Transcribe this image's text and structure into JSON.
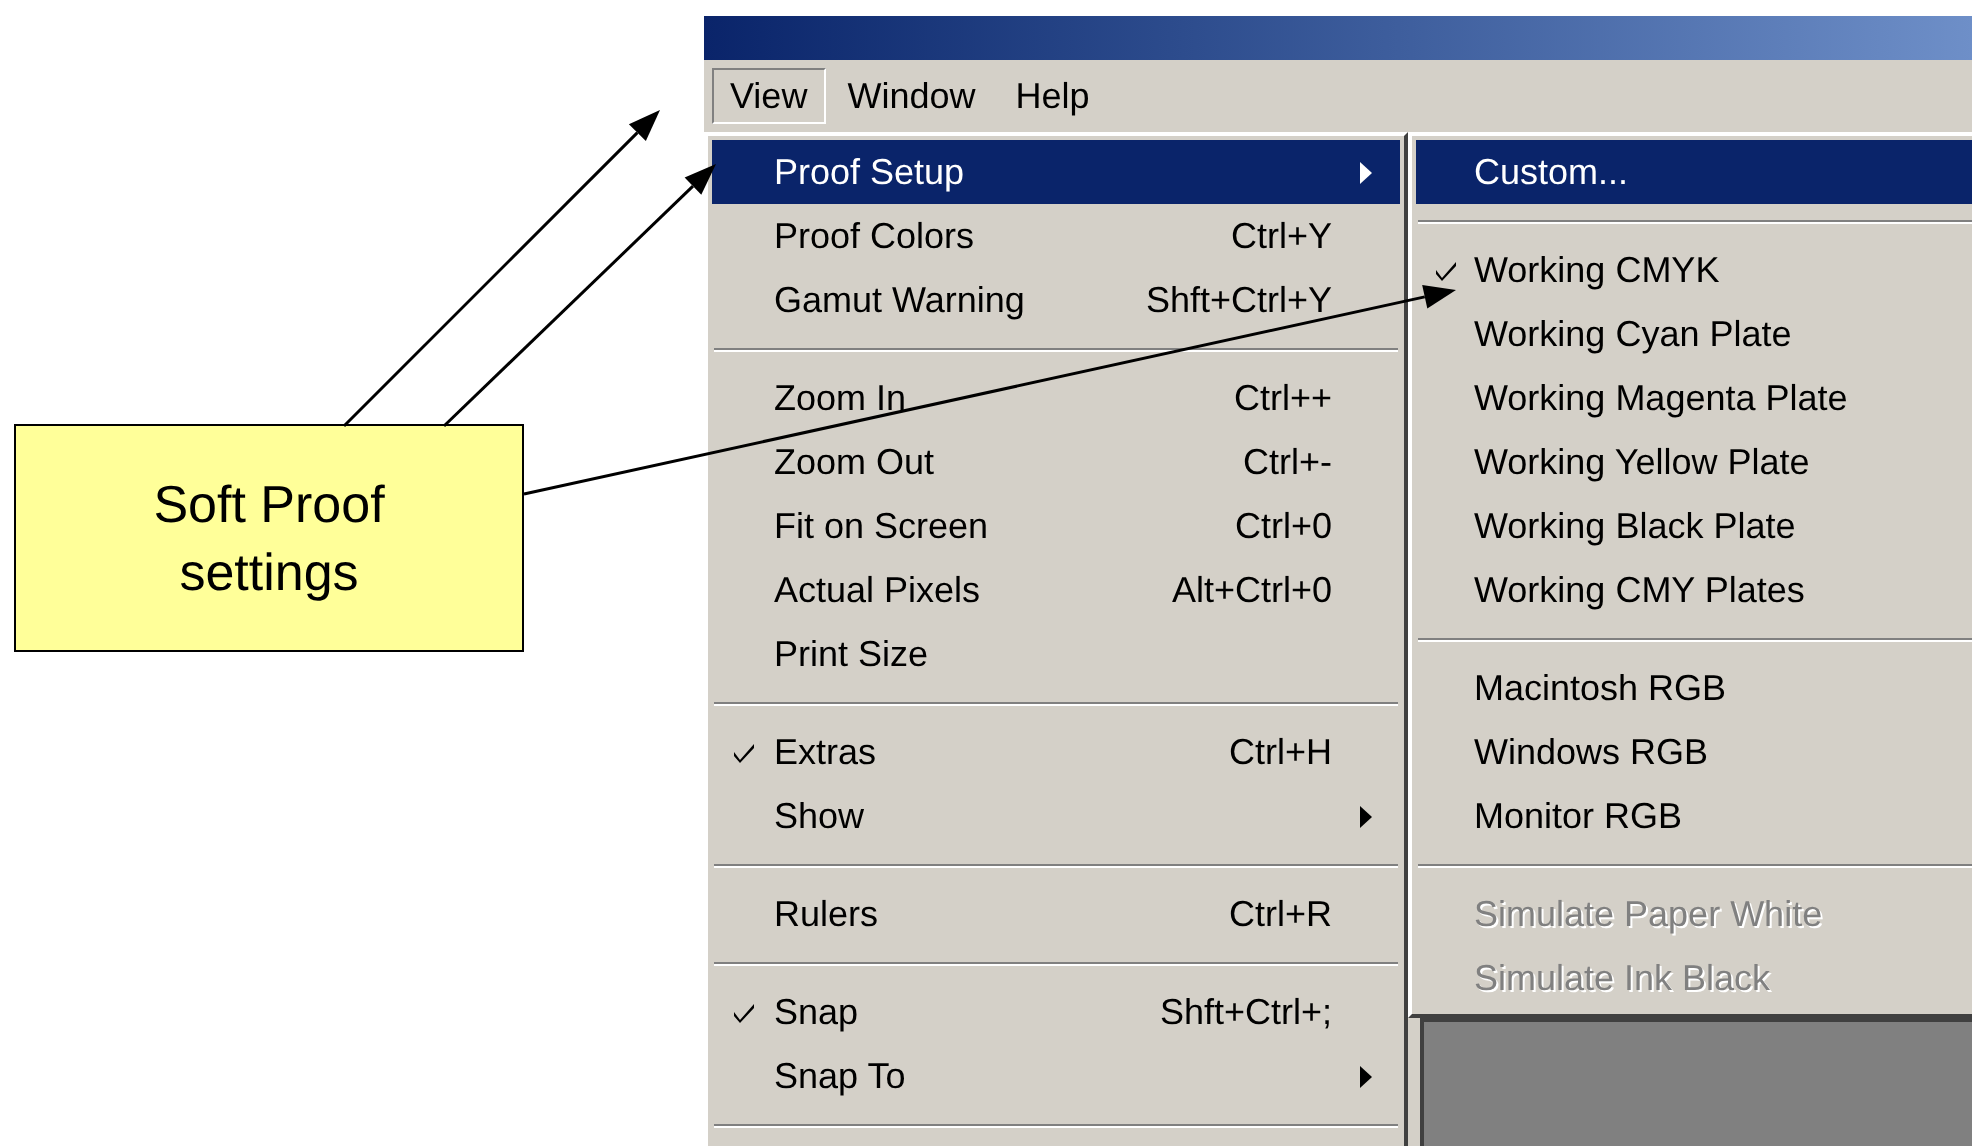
{
  "menu_bar": [
    {
      "label": "View",
      "selected": true
    },
    {
      "label": "Window",
      "selected": false
    },
    {
      "label": "Help",
      "selected": false
    }
  ],
  "view_menu": {
    "items": [
      {
        "kind": "item",
        "label": "Proof Setup",
        "checked": false,
        "selected": true,
        "submenu": true
      },
      {
        "kind": "item",
        "label": "Proof Colors",
        "shortcut": "Ctrl+Y",
        "checked": false,
        "selected": false,
        "submenu": false
      },
      {
        "kind": "item",
        "label": "Gamut Warning",
        "shortcut": "Shft+Ctrl+Y",
        "checked": false,
        "selected": false,
        "submenu": false
      },
      {
        "kind": "separator"
      },
      {
        "kind": "item",
        "label": "Zoom In",
        "shortcut": "Ctrl++",
        "checked": false,
        "selected": false,
        "submenu": false
      },
      {
        "kind": "item",
        "label": "Zoom Out",
        "shortcut": "Ctrl+-",
        "checked": false,
        "selected": false,
        "submenu": false
      },
      {
        "kind": "item",
        "label": "Fit on Screen",
        "shortcut": "Ctrl+0",
        "checked": false,
        "selected": false,
        "submenu": false
      },
      {
        "kind": "item",
        "label": "Actual Pixels",
        "shortcut": "Alt+Ctrl+0",
        "checked": false,
        "selected": false,
        "submenu": false
      },
      {
        "kind": "item",
        "label": "Print Size",
        "checked": false,
        "selected": false,
        "submenu": false
      },
      {
        "kind": "separator"
      },
      {
        "kind": "item",
        "label": "Extras",
        "shortcut": "Ctrl+H",
        "checked": true,
        "selected": false,
        "submenu": false
      },
      {
        "kind": "item",
        "label": "Show",
        "checked": false,
        "selected": false,
        "submenu": true
      },
      {
        "kind": "separator"
      },
      {
        "kind": "item",
        "label": "Rulers",
        "shortcut": "Ctrl+R",
        "checked": false,
        "selected": false,
        "submenu": false
      },
      {
        "kind": "separator"
      },
      {
        "kind": "item",
        "label": "Snap",
        "shortcut": "Shft+Ctrl+;",
        "checked": true,
        "selected": false,
        "submenu": false
      },
      {
        "kind": "item",
        "label": "Snap To",
        "checked": false,
        "selected": false,
        "submenu": true
      },
      {
        "kind": "separator"
      }
    ]
  },
  "proof_setup_submenu": {
    "items": [
      {
        "kind": "item",
        "label": "Custom...",
        "checked": false,
        "selected": true,
        "disabled": false
      },
      {
        "kind": "separator"
      },
      {
        "kind": "item",
        "label": "Working CMYK",
        "checked": true,
        "selected": false,
        "disabled": false
      },
      {
        "kind": "item",
        "label": "Working Cyan Plate",
        "checked": false,
        "selected": false,
        "disabled": false
      },
      {
        "kind": "item",
        "label": "Working Magenta Plate",
        "checked": false,
        "selected": false,
        "disabled": false
      },
      {
        "kind": "item",
        "label": "Working Yellow Plate",
        "checked": false,
        "selected": false,
        "disabled": false
      },
      {
        "kind": "item",
        "label": "Working Black Plate",
        "checked": false,
        "selected": false,
        "disabled": false
      },
      {
        "kind": "item",
        "label": "Working CMY Plates",
        "checked": false,
        "selected": false,
        "disabled": false
      },
      {
        "kind": "separator"
      },
      {
        "kind": "item",
        "label": "Macintosh RGB",
        "checked": false,
        "selected": false,
        "disabled": false
      },
      {
        "kind": "item",
        "label": "Windows RGB",
        "checked": false,
        "selected": false,
        "disabled": false
      },
      {
        "kind": "item",
        "label": "Monitor RGB",
        "checked": false,
        "selected": false,
        "disabled": false
      },
      {
        "kind": "separator"
      },
      {
        "kind": "item",
        "label": "Simulate Paper White",
        "checked": false,
        "selected": false,
        "disabled": true
      },
      {
        "kind": "item",
        "label": "Simulate Ink Black",
        "checked": false,
        "selected": false,
        "disabled": true
      }
    ]
  },
  "callout": {
    "text": "Soft Proof settings"
  }
}
